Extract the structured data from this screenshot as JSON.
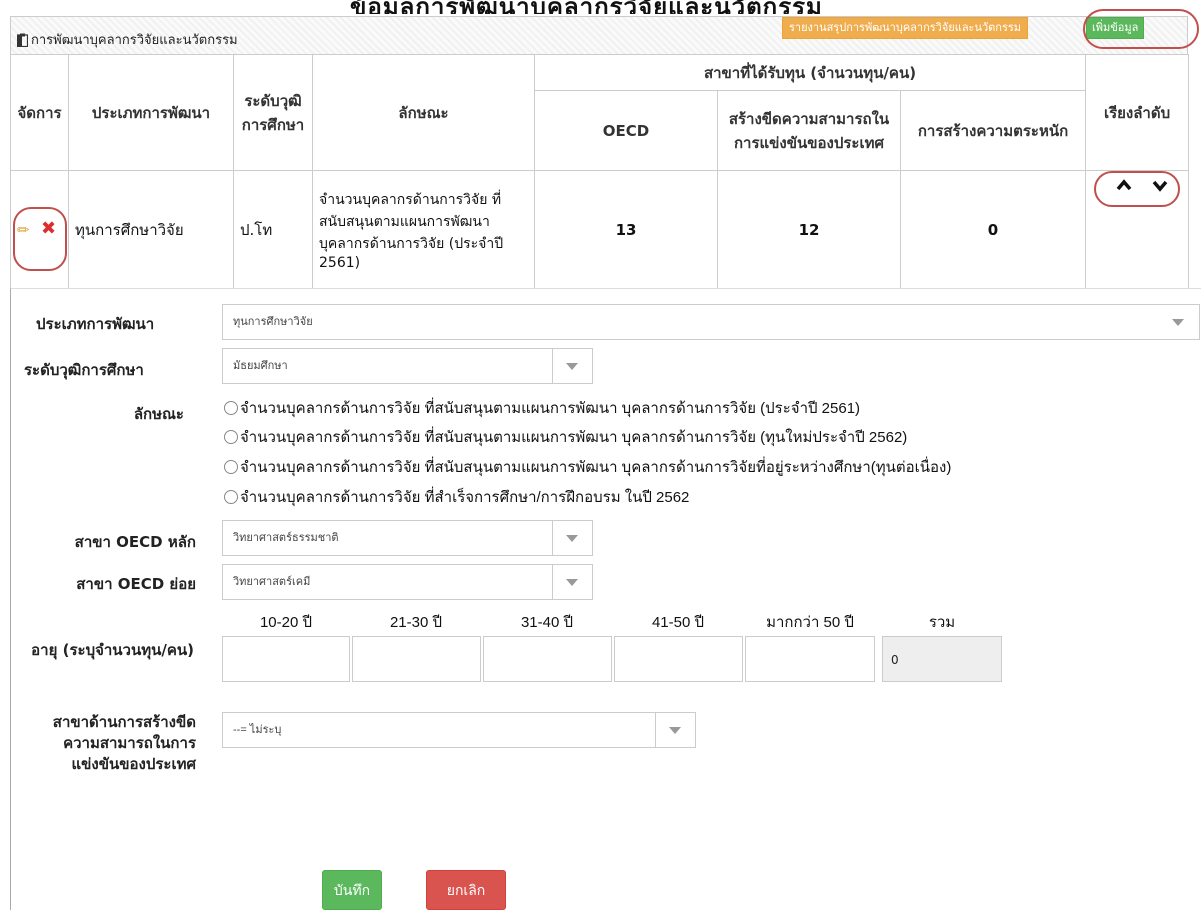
{
  "header": {
    "title_top": "ข้อมูลการพัฒนาบุคลากรวิจัยและนวัตกรรม",
    "title": "การพัฒนาบุคลากรวิจัยและนวัตกรรม",
    "report_button": "รายงานสรุปการพัฒนาบุคลากรวิจัยและนวัตกรรม",
    "add_button": "เพิ่มข้อมูล"
  },
  "table": {
    "headers": {
      "manage": "จัดการ",
      "dev_type": "ประเภทการพัฒนา",
      "edu_level": "ระดับวุฒิการศึกษา",
      "character": "ลักษณะ",
      "branch_group": "สาขาที่ได้รับทุน (จำนวนทุน/คน)",
      "oecd": "OECD",
      "competitiveness": "สร้างขีดความสามารถในการแข่งขันของประเทศ",
      "awareness": "การสร้างความตระหนัก",
      "order": "เรียงลำดับ"
    },
    "row": {
      "dev_type": "ทุนการศึกษาวิจัย",
      "edu_level": "ป.โท",
      "character": "จำนวนบุคลากรด้านการวิจัย ที่สนับสนุนตามแผนการพัฒนา บุคลากรด้านการวิจัย (ประจำปี 2561)",
      "oecd": "13",
      "competitiveness": "12",
      "awareness": "0"
    }
  },
  "icons": {
    "edit": "pencil-icon",
    "delete": "x-icon",
    "up": "chevron-up-icon",
    "down": "chevron-down-icon",
    "header": "clipboard-icon"
  },
  "colors": {
    "report_button": "#f0ad4e",
    "add_button": "#5cb85c",
    "save_button": "#5cb85c",
    "cancel_button": "#d9534f",
    "annotation": "#c0504d"
  },
  "form": {
    "dev_type_label": "ประเภทการพัฒนา",
    "dev_type_value": "ทุนการศึกษาวิจัย",
    "edu_level_label": "ระดับวุฒิการศึกษา",
    "edu_level_value": "มัธยมศึกษา",
    "character_label": "ลักษณะ",
    "character_options": [
      "จำนวนบุคลากรด้านการวิจัย ที่สนับสนุนตามแผนการพัฒนา บุคลากรด้านการวิจัย (ประจำปี 2561)",
      "จำนวนบุคลากรด้านการวิจัย ที่สนับสนุนตามแผนการพัฒนา บุคลากรด้านการวิจัย (ทุนใหม่ประจำปี 2562)",
      "จำนวนบุคลากรด้านการวิจัย ที่สนับสนุนตามแผนการพัฒนา บุคลากรด้านการวิจัยที่อยู่ระหว่างศึกษา(ทุนต่อเนื่อง)",
      "จำนวนบุคลากรด้านการวิจัย ที่สำเร็จการศึกษา/การฝึกอบรม ในปี 2562"
    ],
    "oecd_main_label": "สาขา OECD หลัก",
    "oecd_main_value": "วิทยาศาสตร์ธรรมชาติ",
    "oecd_sub_label": "สาขา OECD ย่อย",
    "oecd_sub_value": "วิทยาศาสตร์เคมี",
    "age_label": "อายุ (ระบุจำนวนทุน/คน)",
    "age_headers": [
      "10-20 ปี",
      "21-30 ปี",
      "31-40 ปี",
      "41-50 ปี",
      "มากกว่า 50 ปี",
      "รวม"
    ],
    "age_total": "0",
    "competitiveness_label": "สาขาด้านการสร้างขีดความสามารถในการแข่งขันของประเทศ",
    "competitiveness_value": "--= ไม่ระบุ",
    "save_button": "บันทึก",
    "cancel_button": "ยกเลิก"
  }
}
